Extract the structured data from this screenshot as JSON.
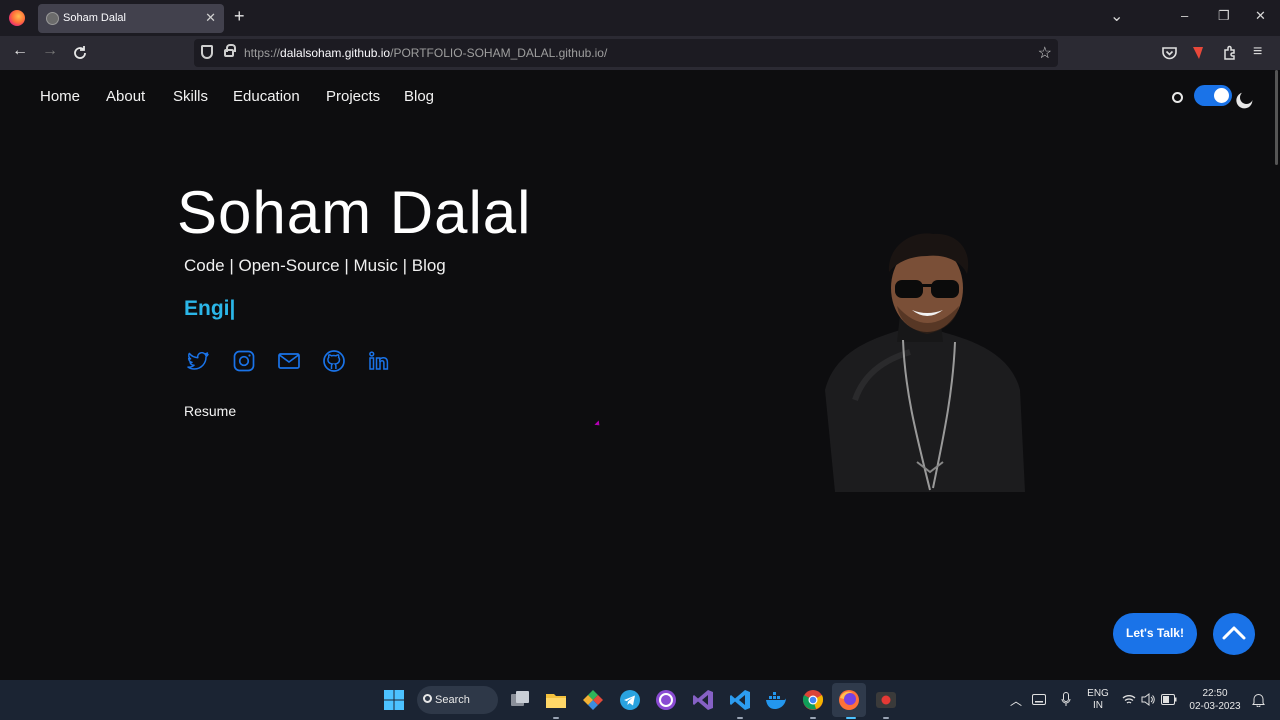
{
  "browser": {
    "tab_title": "Soham Dalal",
    "tab_close": "✕",
    "new_tab": "+",
    "url_domain": "dalalsoham.github.io",
    "url_prefix": "https://",
    "url_path": "/PORTFOLIO-SOHAM_DALAL.github.io/",
    "window_controls": [
      "–",
      "❐",
      "✕"
    ],
    "chevron": "⌄"
  },
  "nav": {
    "links": [
      "Home",
      "About",
      "Skills",
      "Education",
      "Projects",
      "Blog"
    ],
    "theme_toggle_on": true
  },
  "hero": {
    "name": "Soham Dalal",
    "tagline": "Code | Open-Source | Music | Blog",
    "typed_text": "Engi|",
    "socials": [
      "twitter-icon",
      "instagram-icon",
      "mail-icon",
      "github-icon",
      "linkedin-icon"
    ],
    "resume": "Resume"
  },
  "actions": {
    "lets_talk": "Let's Talk!"
  },
  "taskbar": {
    "search": "Search",
    "lang_top": "ENG",
    "lang_bottom": "IN",
    "time": "22:50",
    "date": "02-03-2023"
  },
  "colors": {
    "accent": "#1a73e8",
    "typed": "#2bb6e8",
    "social": "#1a73e8",
    "background": "#0d0d0f"
  }
}
